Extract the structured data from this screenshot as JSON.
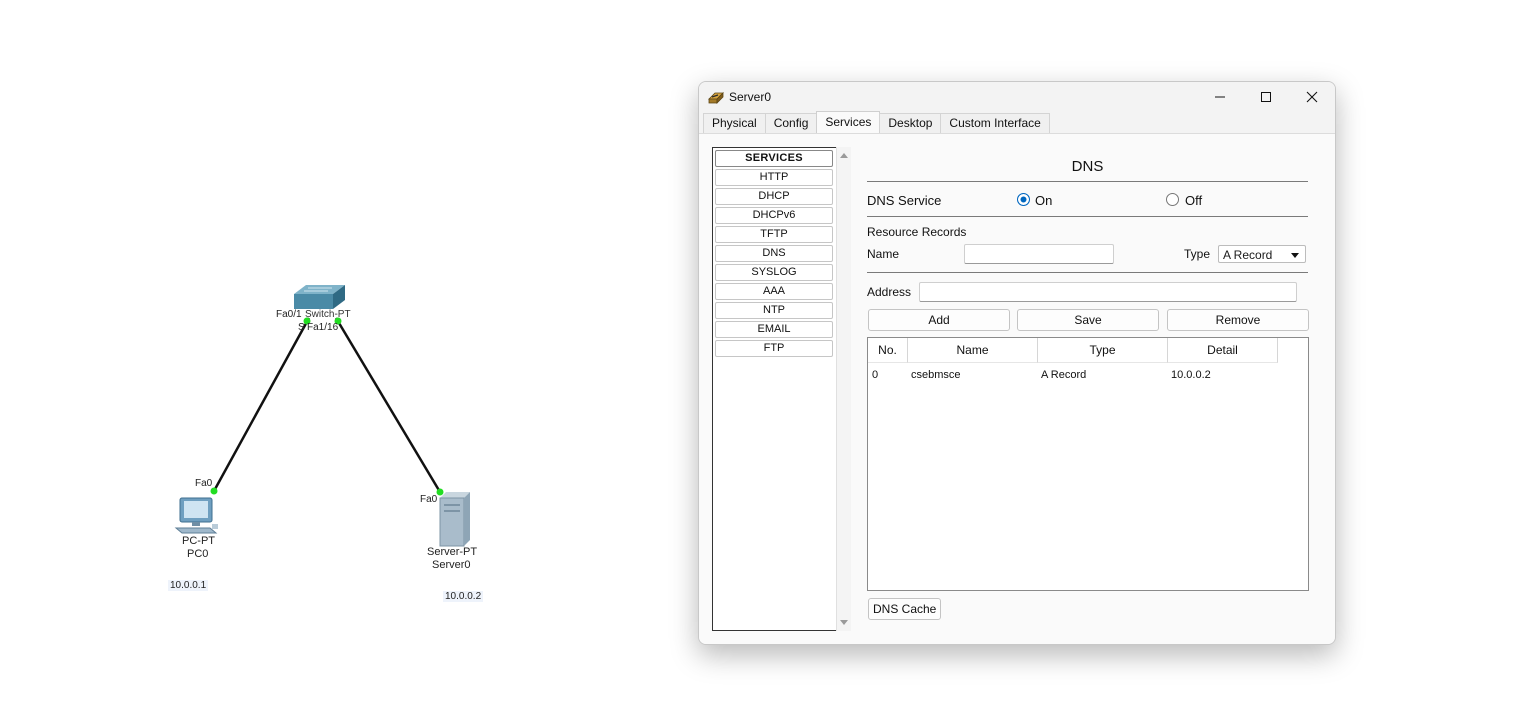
{
  "topology": {
    "switch": {
      "label_a": "Fa0/1",
      "label_b": "Switch-PT",
      "label_c": "S",
      "label_d": "Fa1/16"
    },
    "pc": {
      "type": "PC-PT",
      "name": "PC0",
      "port": "Fa0",
      "ip": "10.0.0.1"
    },
    "server": {
      "type": "Server-PT",
      "name": "Server0",
      "port": "Fa0",
      "ip": "10.0.0.2"
    },
    "colors": {
      "link": "#111111",
      "port_up": "#22dd22"
    }
  },
  "window": {
    "title": "Server0",
    "controls": {
      "minimize": "minimize-icon",
      "maximize": "maximize-icon",
      "close": "close-icon"
    },
    "tabs": [
      "Physical",
      "Config",
      "Services",
      "Desktop",
      "Custom Interface"
    ],
    "active_tab": "Services",
    "services": {
      "header": "SERVICES",
      "items": [
        "HTTP",
        "DHCP",
        "DHCPv6",
        "TFTP",
        "DNS",
        "SYSLOG",
        "AAA",
        "NTP",
        "EMAIL",
        "FTP"
      ]
    },
    "dns": {
      "title": "DNS",
      "service_label": "DNS Service",
      "on_label": "On",
      "off_label": "Off",
      "service_state": "On",
      "records_label": "Resource Records",
      "name_label": "Name",
      "name_value": "",
      "type_label": "Type",
      "type_value": "A Record",
      "address_label": "Address",
      "address_value": "",
      "buttons": {
        "add": "Add",
        "save": "Save",
        "remove": "Remove"
      },
      "table": {
        "columns": [
          "No.",
          "Name",
          "Type",
          "Detail"
        ],
        "rows": [
          {
            "no": "0",
            "name": "csebmsce",
            "type": "A Record",
            "detail": "10.0.0.2"
          }
        ]
      },
      "cache_button": "DNS Cache"
    }
  }
}
